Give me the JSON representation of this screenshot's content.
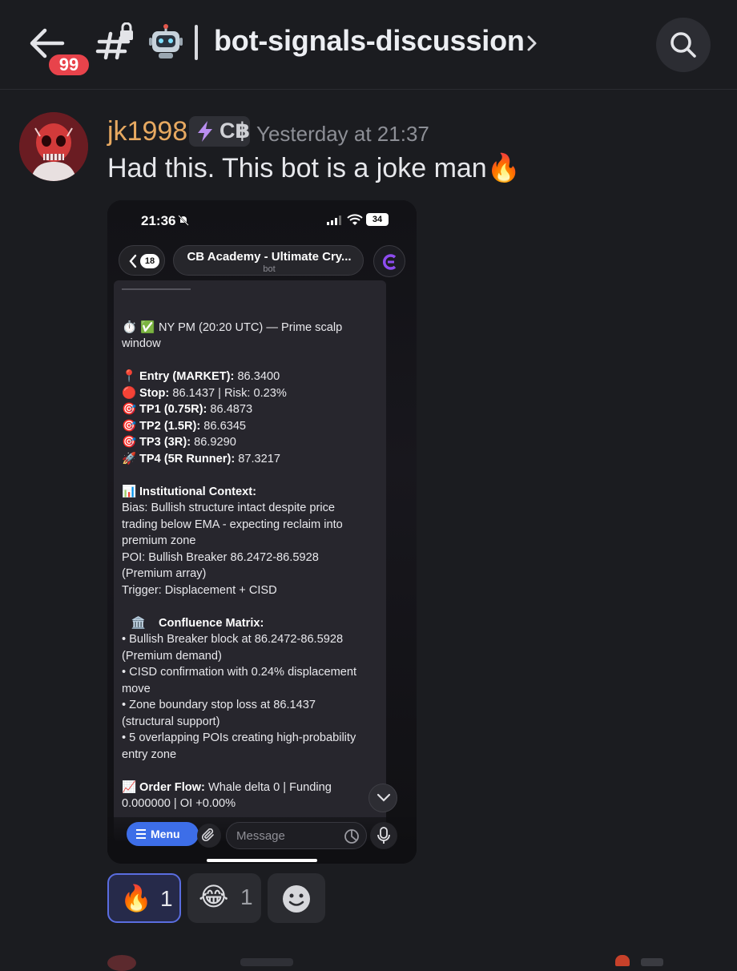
{
  "header": {
    "unread_badge": "99",
    "channel_emoji": "🤖",
    "channel_name": "bot-signals-discussion",
    "icons": [
      "back-arrow-icon",
      "locked-hashtag-icon",
      "robot-icon",
      "chevron-right-icon",
      "search-icon"
    ]
  },
  "post": {
    "username": "jk1998",
    "tag_text": "C฿",
    "timestamp": "Yesterday at 21:37",
    "message": "Had this. This bot is a joke man🔥",
    "colors": {
      "username": "#e7a961",
      "accent": "#5a6de0",
      "badge": "#e8434b"
    }
  },
  "screenshot": {
    "status_time": "21:36",
    "battery": "34",
    "back_count": "18",
    "chat_title": "CB Academy - Ultimate Cry...",
    "chat_subtitle": "bot",
    "lines": [
      {
        "emoji": "",
        "bold": "",
        "text": ""
      },
      {
        "emoji": "⏱️ ✅",
        "bold": "",
        "text": "NY PM (20:20 UTC) — Prime scalp"
      },
      {
        "emoji": "",
        "bold": "",
        "text": "window"
      },
      {
        "emoji": "",
        "bold": "",
        "text": ""
      },
      {
        "emoji": "📍",
        "bold": "Entry (MARKET):",
        "text": "86.3400"
      },
      {
        "emoji": "🔴",
        "bold": "Stop:",
        "text": "86.1437 | Risk: 0.23%"
      },
      {
        "emoji": "🎯",
        "bold": "TP1 (0.75R):",
        "text": "86.4873"
      },
      {
        "emoji": "🎯",
        "bold": "TP2 (1.5R):",
        "text": "86.6345"
      },
      {
        "emoji": "🎯",
        "bold": "TP3 (3R):",
        "text": "86.9290"
      },
      {
        "emoji": "🚀",
        "bold": "TP4 (5R Runner):",
        "text": "87.3217"
      },
      {
        "emoji": "",
        "bold": "",
        "text": ""
      },
      {
        "emoji": "📊",
        "bold": "Institutional Context:",
        "text": ""
      },
      {
        "emoji": "",
        "bold": "",
        "text": "  Bias: Bullish structure intact despite price"
      },
      {
        "emoji": "",
        "bold": "",
        "text": "trading below EMA - expecting reclaim into"
      },
      {
        "emoji": "",
        "bold": "",
        "text": "premium zone"
      },
      {
        "emoji": "",
        "bold": "",
        "text": "  POI: Bullish Breaker 86.2472-86.5928"
      },
      {
        "emoji": "",
        "bold": "",
        "text": "(Premium array)"
      },
      {
        "emoji": "",
        "bold": "",
        "text": "  Trigger: Displacement + CISD"
      },
      {
        "emoji": "",
        "bold": "",
        "text": ""
      },
      {
        "emoji": "🏛️",
        "bold": "Confluence Matrix:",
        "text": ""
      },
      {
        "emoji": "",
        "bold": "",
        "text": "  • Bullish Breaker block at 86.2472-86.5928"
      },
      {
        "emoji": "",
        "bold": "",
        "text": "(Premium demand)"
      },
      {
        "emoji": "",
        "bold": "",
        "text": "  • CISD confirmation with 0.24% displacement"
      },
      {
        "emoji": "",
        "bold": "",
        "text": "move"
      },
      {
        "emoji": "",
        "bold": "",
        "text": "  • Zone boundary stop loss at 86.1437"
      },
      {
        "emoji": "",
        "bold": "",
        "text": "(structural support)"
      },
      {
        "emoji": "",
        "bold": "",
        "text": "  • 5 overlapping POIs creating high-probability"
      },
      {
        "emoji": "",
        "bold": "",
        "text": "entry zone"
      },
      {
        "emoji": "",
        "bold": "",
        "text": ""
      },
      {
        "emoji": "📈",
        "bold": "Order Flow:",
        "text": "Whale delta 0 | Funding"
      },
      {
        "emoji": "",
        "bold": "",
        "text": "0.000000 | OI +0.00%"
      }
    ],
    "menu_label": "Menu",
    "input_placeholder": "Message"
  },
  "reactions": [
    {
      "emoji": "🔥",
      "count": "1",
      "active": true
    },
    {
      "emoji": "😂",
      "count": "1",
      "active": false
    }
  ]
}
